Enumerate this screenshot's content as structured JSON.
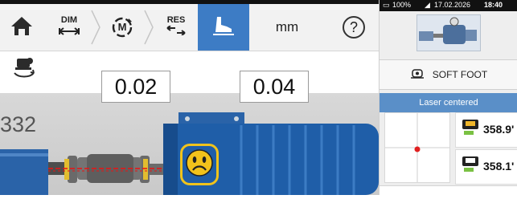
{
  "toolbar": {
    "buttons": [
      {
        "id": "home",
        "icon": "home-icon"
      },
      {
        "id": "dim",
        "label": "DIM",
        "icon": "dim-arrows-icon"
      },
      {
        "id": "measure",
        "label": "M",
        "icon": "measure-rotate-icon"
      },
      {
        "id": "res",
        "label": "RES",
        "icon": "results-icon"
      },
      {
        "id": "softfoot",
        "icon": "soft-foot-icon",
        "active": true
      },
      {
        "id": "units",
        "label": "mm"
      },
      {
        "id": "help",
        "label": "?",
        "icon": "help-icon"
      }
    ],
    "second_row": {
      "icon": "machine-swap-icon"
    }
  },
  "canvas": {
    "value_left": "0.02",
    "value_right": "0.04",
    "side_value": "332"
  },
  "right_panel": {
    "status": {
      "battery": "100%",
      "date": "17.02.2026",
      "time": "18:40"
    },
    "soft_foot_label": "SOFT FOOT",
    "laser_status": "Laser centered",
    "detector_top": "358.9'",
    "detector_bottom": "358.1'"
  },
  "colors": {
    "accent": "#3d7cc5",
    "laser_bar": "#5a8fc8",
    "motor_blue": "#1f5ea8",
    "smiley": "#f2c21b"
  }
}
